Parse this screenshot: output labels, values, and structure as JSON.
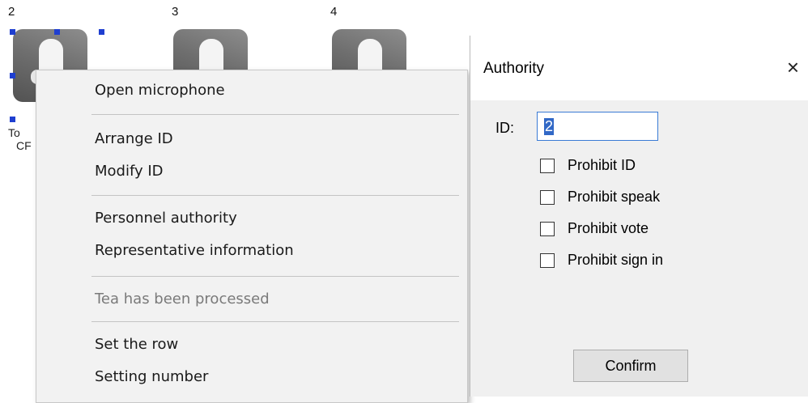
{
  "seats": [
    {
      "number": "2",
      "sublabel_1": "To",
      "sublabel_2": "CF"
    },
    {
      "number": "3"
    },
    {
      "number": "4"
    }
  ],
  "context_menu": {
    "open_microphone": "Open microphone",
    "arrange_id": "Arrange ID",
    "modify_id": "Modify ID",
    "personnel_authority": "Personnel authority",
    "representative_information": "Representative information",
    "tea_processed": "Tea has been processed",
    "set_row": "Set the row",
    "setting_number": "Setting number"
  },
  "authority_dialog": {
    "title": "Authority",
    "close_glyph": "×",
    "id_label": "ID:",
    "id_value": "2",
    "checkboxes": [
      {
        "label": "Prohibit ID",
        "checked": false
      },
      {
        "label": "Prohibit speak",
        "checked": false
      },
      {
        "label": "Prohibit vote",
        "checked": false
      },
      {
        "label": "Prohibit sign in",
        "checked": false
      }
    ],
    "confirm_label": "Confirm"
  },
  "colors": {
    "selection_handle": "#1f3fd0",
    "input_border": "#3a7bd5",
    "text_selection": "#3168c6"
  }
}
